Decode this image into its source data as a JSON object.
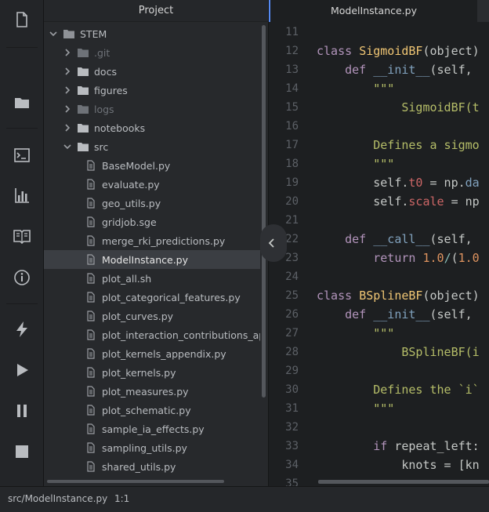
{
  "project_panel": {
    "title": "Project"
  },
  "tree": {
    "root": "STEM",
    "folders": [
      {
        "name": ".git",
        "expanded": false,
        "dim": true
      },
      {
        "name": "docs",
        "expanded": false,
        "dim": false
      },
      {
        "name": "figures",
        "expanded": false,
        "dim": false
      },
      {
        "name": "logs",
        "expanded": false,
        "dim": true
      },
      {
        "name": "notebooks",
        "expanded": false,
        "dim": false
      },
      {
        "name": "src",
        "expanded": true,
        "dim": false
      }
    ],
    "files": [
      "BaseModel.py",
      "evaluate.py",
      "geo_utils.py",
      "gridjob.sge",
      "merge_rki_predictions.py",
      "ModelInstance.py",
      "plot_all.sh",
      "plot_categorical_features.py",
      "plot_curves.py",
      "plot_interaction_contributions_appe",
      "plot_kernels_appendix.py",
      "plot_kernels.py",
      "plot_measures.py",
      "plot_schematic.py",
      "sample_ia_effects.py",
      "sampling_utils.py",
      "shared_utils.py"
    ],
    "selected_file": "ModelInstance.py"
  },
  "editor": {
    "tab_title": "ModelInstance.py",
    "line_numbers": [
      "11",
      "12",
      "13",
      "14",
      "15",
      "16",
      "17",
      "18",
      "19",
      "20",
      "21",
      "22",
      "23",
      "24",
      "25",
      "26",
      "27",
      "28",
      "29",
      "30",
      "31",
      "32",
      "33",
      "34",
      "35"
    ],
    "lines": [
      [],
      [
        [
          "kw",
          "class "
        ],
        [
          "cls",
          "SigmoidBF"
        ],
        [
          "",
          "(object)"
        ]
      ],
      [
        [
          "",
          "    "
        ],
        [
          "kw",
          "def "
        ],
        [
          "fn",
          "__init__"
        ],
        [
          "",
          "(self, "
        ]
      ],
      [
        [
          "str",
          "        \"\"\""
        ]
      ],
      [
        [
          "str",
          "            SigmoidBF(t"
        ]
      ],
      [],
      [
        [
          "str",
          "        Defines a sigmo"
        ]
      ],
      [
        [
          "str",
          "        \"\"\""
        ]
      ],
      [
        [
          "",
          "        self."
        ],
        [
          "attr",
          "t0"
        ],
        [
          "",
          " = np."
        ],
        [
          "fn",
          "da"
        ]
      ],
      [
        [
          "",
          "        self."
        ],
        [
          "attr",
          "scale"
        ],
        [
          "",
          " = np"
        ]
      ],
      [],
      [
        [
          "",
          "    "
        ],
        [
          "kw",
          "def "
        ],
        [
          "fn",
          "__call__"
        ],
        [
          "",
          "(self, "
        ]
      ],
      [
        [
          "",
          "        "
        ],
        [
          "kw",
          "return "
        ],
        [
          "num",
          "1.0"
        ],
        [
          "op",
          "/"
        ],
        [
          "",
          "("
        ],
        [
          "num",
          "1.0"
        ]
      ],
      [],
      [
        [
          "kw",
          "class "
        ],
        [
          "cls",
          "BSplineBF"
        ],
        [
          "",
          "(object)"
        ]
      ],
      [
        [
          "",
          "    "
        ],
        [
          "kw",
          "def "
        ],
        [
          "fn",
          "__init__"
        ],
        [
          "",
          "(self, "
        ]
      ],
      [
        [
          "str",
          "        \"\"\""
        ]
      ],
      [
        [
          "str",
          "            BSplineBF(i"
        ]
      ],
      [],
      [
        [
          "str",
          "        Defines the `i`"
        ]
      ],
      [
        [
          "str",
          "        \"\"\""
        ]
      ],
      [],
      [
        [
          "",
          "        "
        ],
        [
          "kw",
          "if "
        ],
        [
          "",
          "repeat_left:"
        ]
      ],
      [
        [
          "",
          "            knots = [kn"
        ]
      ],
      []
    ]
  },
  "status": {
    "file_path": "src/ModelInstance.py",
    "cursor": "1:1"
  },
  "colors": {
    "accent": "#568af2",
    "background": "#1d1f21",
    "panel": "#27292c",
    "selection": "#3b3e43"
  },
  "icons": {
    "activity_bar": [
      "file-icon",
      "folder-icon",
      "terminal-icon",
      "bar-chart-icon",
      "book-icon",
      "info-icon",
      "lightning-icon",
      "play-icon",
      "pause-icon",
      "stop-icon"
    ]
  }
}
